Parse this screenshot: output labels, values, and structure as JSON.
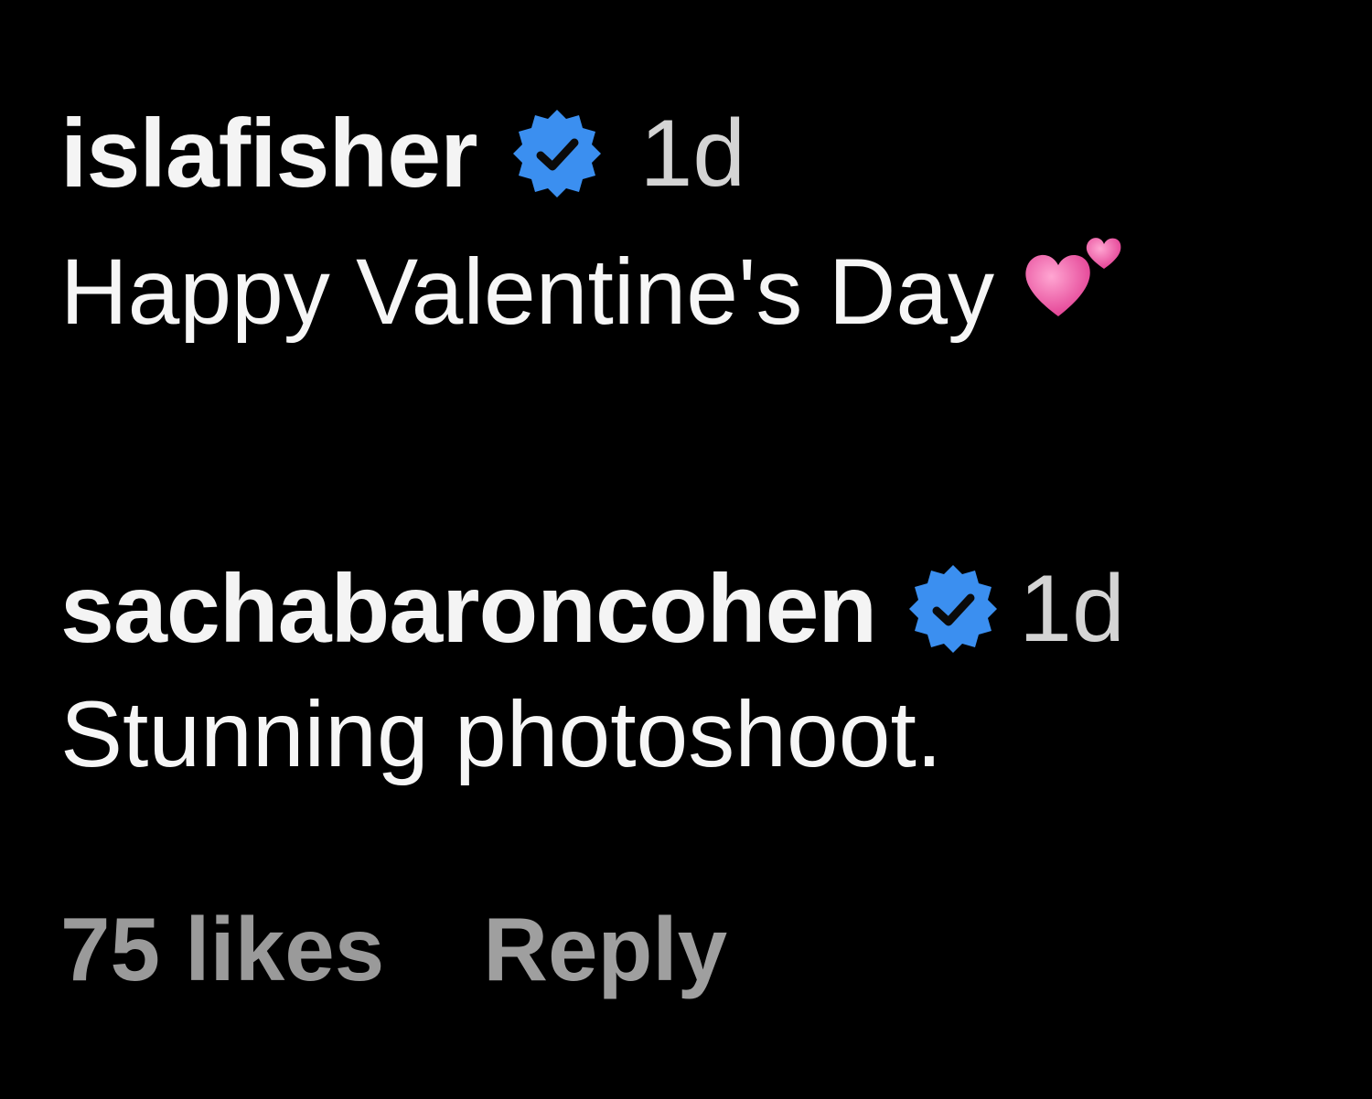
{
  "comments": [
    {
      "username": "islafisher",
      "verified": true,
      "timestamp": "1d",
      "text": "Happy Valentine's Day",
      "emoji": "two-hearts-icon"
    },
    {
      "username": "sachabaroncohen",
      "verified": true,
      "timestamp": "1d",
      "text": "Stunning photoshoot."
    }
  ],
  "footer": {
    "likes_label": "75 likes",
    "reply_label": "Reply"
  },
  "colors": {
    "background": "#000000",
    "verified_blue": "#3897f0",
    "heart_pink": "#ef5aa8",
    "muted_text": "#9a9a9a"
  }
}
